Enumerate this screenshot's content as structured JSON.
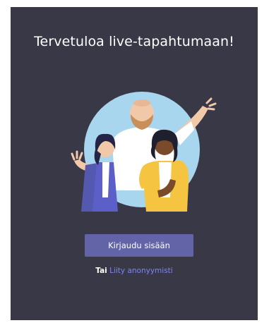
{
  "welcome": {
    "title": "Tervetuloa live-tapahtumaan!",
    "illustration_icon": "people-waving-illustration"
  },
  "actions": {
    "signin_label": "Kirjaudu sisään",
    "alt_prefix": "Tai",
    "anonymous_link": "Liity anonyymisti"
  },
  "colors": {
    "panel_bg": "#383846",
    "accent": "#6264a7",
    "link": "#7f85f5"
  }
}
